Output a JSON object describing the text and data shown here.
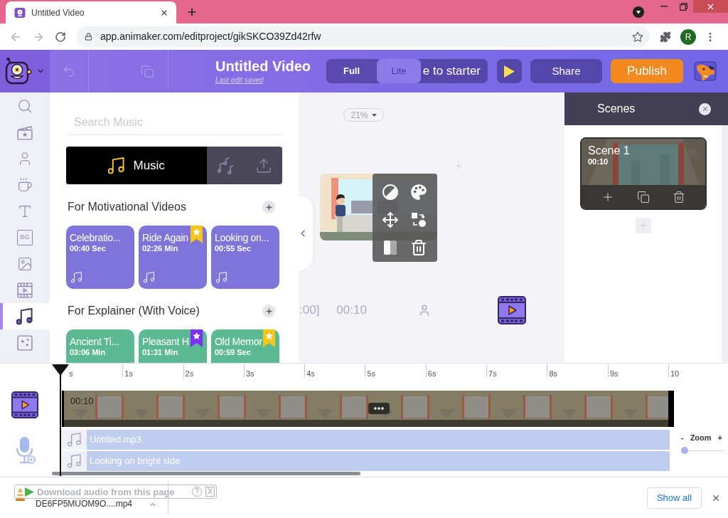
{
  "browser": {
    "tab": {
      "title": "Untitled Video"
    },
    "address": {
      "url": "app.animaker.com/editproject/gikSKCO39Zd42rfw"
    },
    "profile": {
      "initial": "R"
    }
  },
  "header": {
    "title": "Untitled Video",
    "status": "Last edit saved",
    "modes": [
      {
        "label": "Full",
        "selected": true
      },
      {
        "label": "Lite",
        "selected": false
      }
    ],
    "starter_button": "e to starter",
    "share_button": "Share",
    "publish_button": "Publish"
  },
  "sidebar": {
    "items": [
      {
        "kind": "search",
        "selected": false
      },
      {
        "kind": "scenes",
        "selected": false
      },
      {
        "kind": "characters",
        "selected": false
      },
      {
        "kind": "properties",
        "selected": false
      },
      {
        "kind": "text",
        "selected": false
      },
      {
        "kind": "background",
        "label": "BG",
        "selected": false
      },
      {
        "kind": "images",
        "selected": false
      },
      {
        "kind": "videos",
        "selected": false
      },
      {
        "kind": "music",
        "selected": true
      },
      {
        "kind": "effects",
        "selected": false
      }
    ]
  },
  "music_panel": {
    "search": {
      "placeholder": "Search Music"
    },
    "tabs": [
      {
        "kind": "music",
        "label": "Music",
        "selected": true
      },
      {
        "kind": "sound_effects",
        "selected": false
      },
      {
        "kind": "upload",
        "selected": false
      }
    ],
    "sections": [
      {
        "title": "For Motivational Videos",
        "color": "#7f74d9",
        "tracks": [
          {
            "title": "Celebratio...",
            "duration": "00:40 Sec",
            "note_icon": true
          },
          {
            "title": "Ride Again",
            "duration": "02:26 Min",
            "ribbon": {
              "color": "#f5c518"
            },
            "note_icon": true
          },
          {
            "title": "Looking on...",
            "duration": "00:55 Sec",
            "note_icon": true
          }
        ]
      },
      {
        "title": "For Explainer (With Voice)",
        "color": "#5cb994",
        "tracks": [
          {
            "title": "Ancient Ti...",
            "duration": "03:06 Min"
          },
          {
            "title": "Pleasant H",
            "duration": "01:31 Min",
            "ribbon": {
              "color": "#7b2ff7"
            }
          },
          {
            "title": "Old Memor",
            "duration": "00:59 Sec",
            "ribbon": {
              "color": "#f5c518"
            }
          }
        ]
      }
    ]
  },
  "canvas": {
    "zoom": "21%",
    "time_start": ":00]",
    "time_end": "00:10"
  },
  "scenes_panel": {
    "title": "Scenes",
    "scenes": [
      {
        "name": "Scene 1",
        "duration": "00:10",
        "selected": true
      }
    ]
  },
  "timeline": {
    "ticks": [
      "s",
      "1s",
      "2s",
      "3s",
      "4s",
      "5s",
      "6s",
      "7s",
      "8s",
      "9s",
      "10"
    ],
    "video_track": {
      "duration": "00:10"
    },
    "audio_tracks": [
      {
        "name": "Untitled.mp3"
      },
      {
        "name": "Looking on bright side"
      }
    ],
    "zoom": {
      "minus": "-",
      "label": "Zoom",
      "plus": "+",
      "level": 0
    }
  },
  "downloads": {
    "file": "DE6FP5MUOM9O....mp4",
    "overlay": {
      "text": "Download audio from this page",
      "help": "?",
      "close": "X"
    },
    "show_all": "Show all"
  }
}
